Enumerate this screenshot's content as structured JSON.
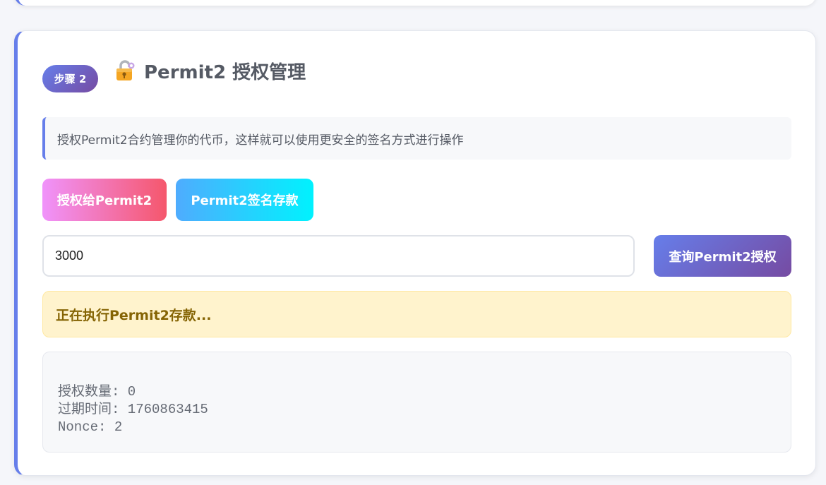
{
  "step": {
    "badge": "步骤 2",
    "icon": "lock-icon",
    "title": "Permit2 授权管理"
  },
  "info": {
    "text": "授权Permit2合约管理你的代币，这样就可以使用更安全的签名方式进行操作"
  },
  "buttons": {
    "approve_label": "授权给Permit2",
    "deposit_label": "Permit2签名存款",
    "query_label": "查询Permit2授权"
  },
  "amount_input": {
    "value": "3000"
  },
  "status": {
    "text": "正在执行Permit2存款..."
  },
  "result": {
    "lines": [
      "授权数量: 0",
      "过期时间: 1760863415",
      "Nonce: 2"
    ]
  },
  "colors": {
    "accent": "#667eea",
    "accent_end": "#764ba2",
    "approve_start": "#f093fb",
    "approve_end": "#f5576c",
    "deposit_start": "#4facfe",
    "deposit_end": "#00f2fe",
    "status_bg": "#fff3cd",
    "status_text": "#856404"
  }
}
